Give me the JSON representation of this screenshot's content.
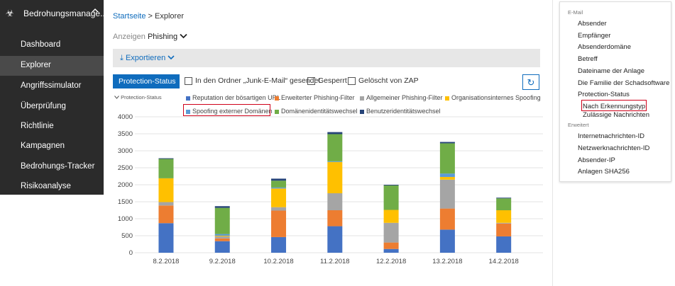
{
  "sidebar": {
    "header_icon": "biohazard-icon",
    "header_title": "Bedrohungsmanage...",
    "header_chevron": "^",
    "items": [
      {
        "label": "Dashboard"
      },
      {
        "label": "Explorer"
      },
      {
        "label": "Angriffssimulator"
      },
      {
        "label": "Überprüfung"
      },
      {
        "label": "Richtlinie"
      },
      {
        "label": "Kampagnen"
      },
      {
        "label": "Bedrohungs-Tracker"
      },
      {
        "label": "Risikoanalyse"
      }
    ]
  },
  "breadcrumb": {
    "home": "Startseite",
    "separator": ">",
    "current": "Explorer"
  },
  "view": {
    "label": "Anzeigen",
    "value": "Phishing",
    "chevron": "chevron-down-icon"
  },
  "toolbar": {
    "export_label": "Exportieren",
    "export_icon": "download-icon"
  },
  "filters": {
    "protection_status_button": "Protection-Status",
    "checkboxes": [
      {
        "label": "In den Ordner „Junk-E-Mail“ gesendet"
      },
      {
        "label": "Gesperrt"
      },
      {
        "label": "Gelöscht von ZAP"
      }
    ],
    "refresh_icon": "refresh-icon"
  },
  "legend": {
    "title": "Protection-Status",
    "highlighted_entry": "Spoofing externer Domänen"
  },
  "chart_data": {
    "type": "bar",
    "stacked": true,
    "categories": [
      "8.2.2018",
      "9.2.2018",
      "10.2.2018",
      "11.2.2018",
      "12.2.2018",
      "13.2.2018",
      "14.2.2018"
    ],
    "ylim": [
      0,
      4000
    ],
    "yticks": [
      0,
      500,
      1000,
      1500,
      2000,
      2500,
      3000,
      3500,
      4000
    ],
    "grid": true,
    "legend_placement": "top",
    "series": [
      {
        "name": "Reputation der bösartigen URL",
        "color": "#4472c4",
        "values": [
          870,
          340,
          460,
          780,
          110,
          680,
          480
        ]
      },
      {
        "name": "Erweiterter Phishing-Filter",
        "color": "#ed7d31",
        "values": [
          520,
          80,
          780,
          470,
          190,
          620,
          380
        ]
      },
      {
        "name": "Allgemeiner Phishing-Filter",
        "color": "#a5a5a5",
        "values": [
          100,
          60,
          100,
          500,
          580,
          850,
          20
        ]
      },
      {
        "name": "Organisationsinternes Spoofing",
        "color": "#ffc000",
        "values": [
          700,
          20,
          550,
          920,
          380,
          80,
          370
        ]
      },
      {
        "name": "Spoofing externer Domänen",
        "color": "#5b9bd5",
        "values": [
          0,
          50,
          30,
          20,
          0,
          100,
          0
        ]
      },
      {
        "name": "Domänenidentitätswechsel",
        "color": "#70ad47",
        "values": [
          570,
          770,
          200,
          800,
          720,
          890,
          350
        ]
      },
      {
        "name": "Benutzeridentitätswechsel",
        "color": "#264478",
        "values": [
          20,
          50,
          60,
          60,
          20,
          40,
          20
        ]
      }
    ]
  },
  "panel": {
    "section_email": "E-Mail",
    "email_options": [
      "Absender",
      "Empfänger",
      "Absenderdomäne",
      "Betreff",
      "Dateiname der Anlage",
      "Die Familie der Schadsoftware",
      "Protection-Status"
    ],
    "sub_options": [
      "Nach Erkennungstyp",
      "Zulässige Nachrichten"
    ],
    "section_advanced": "Erweitert",
    "advanced_options": [
      "Internetnachrichten-ID",
      "Netzwerknachrichten-ID",
      "Absender-IP",
      "Anlagen SHA256"
    ]
  }
}
